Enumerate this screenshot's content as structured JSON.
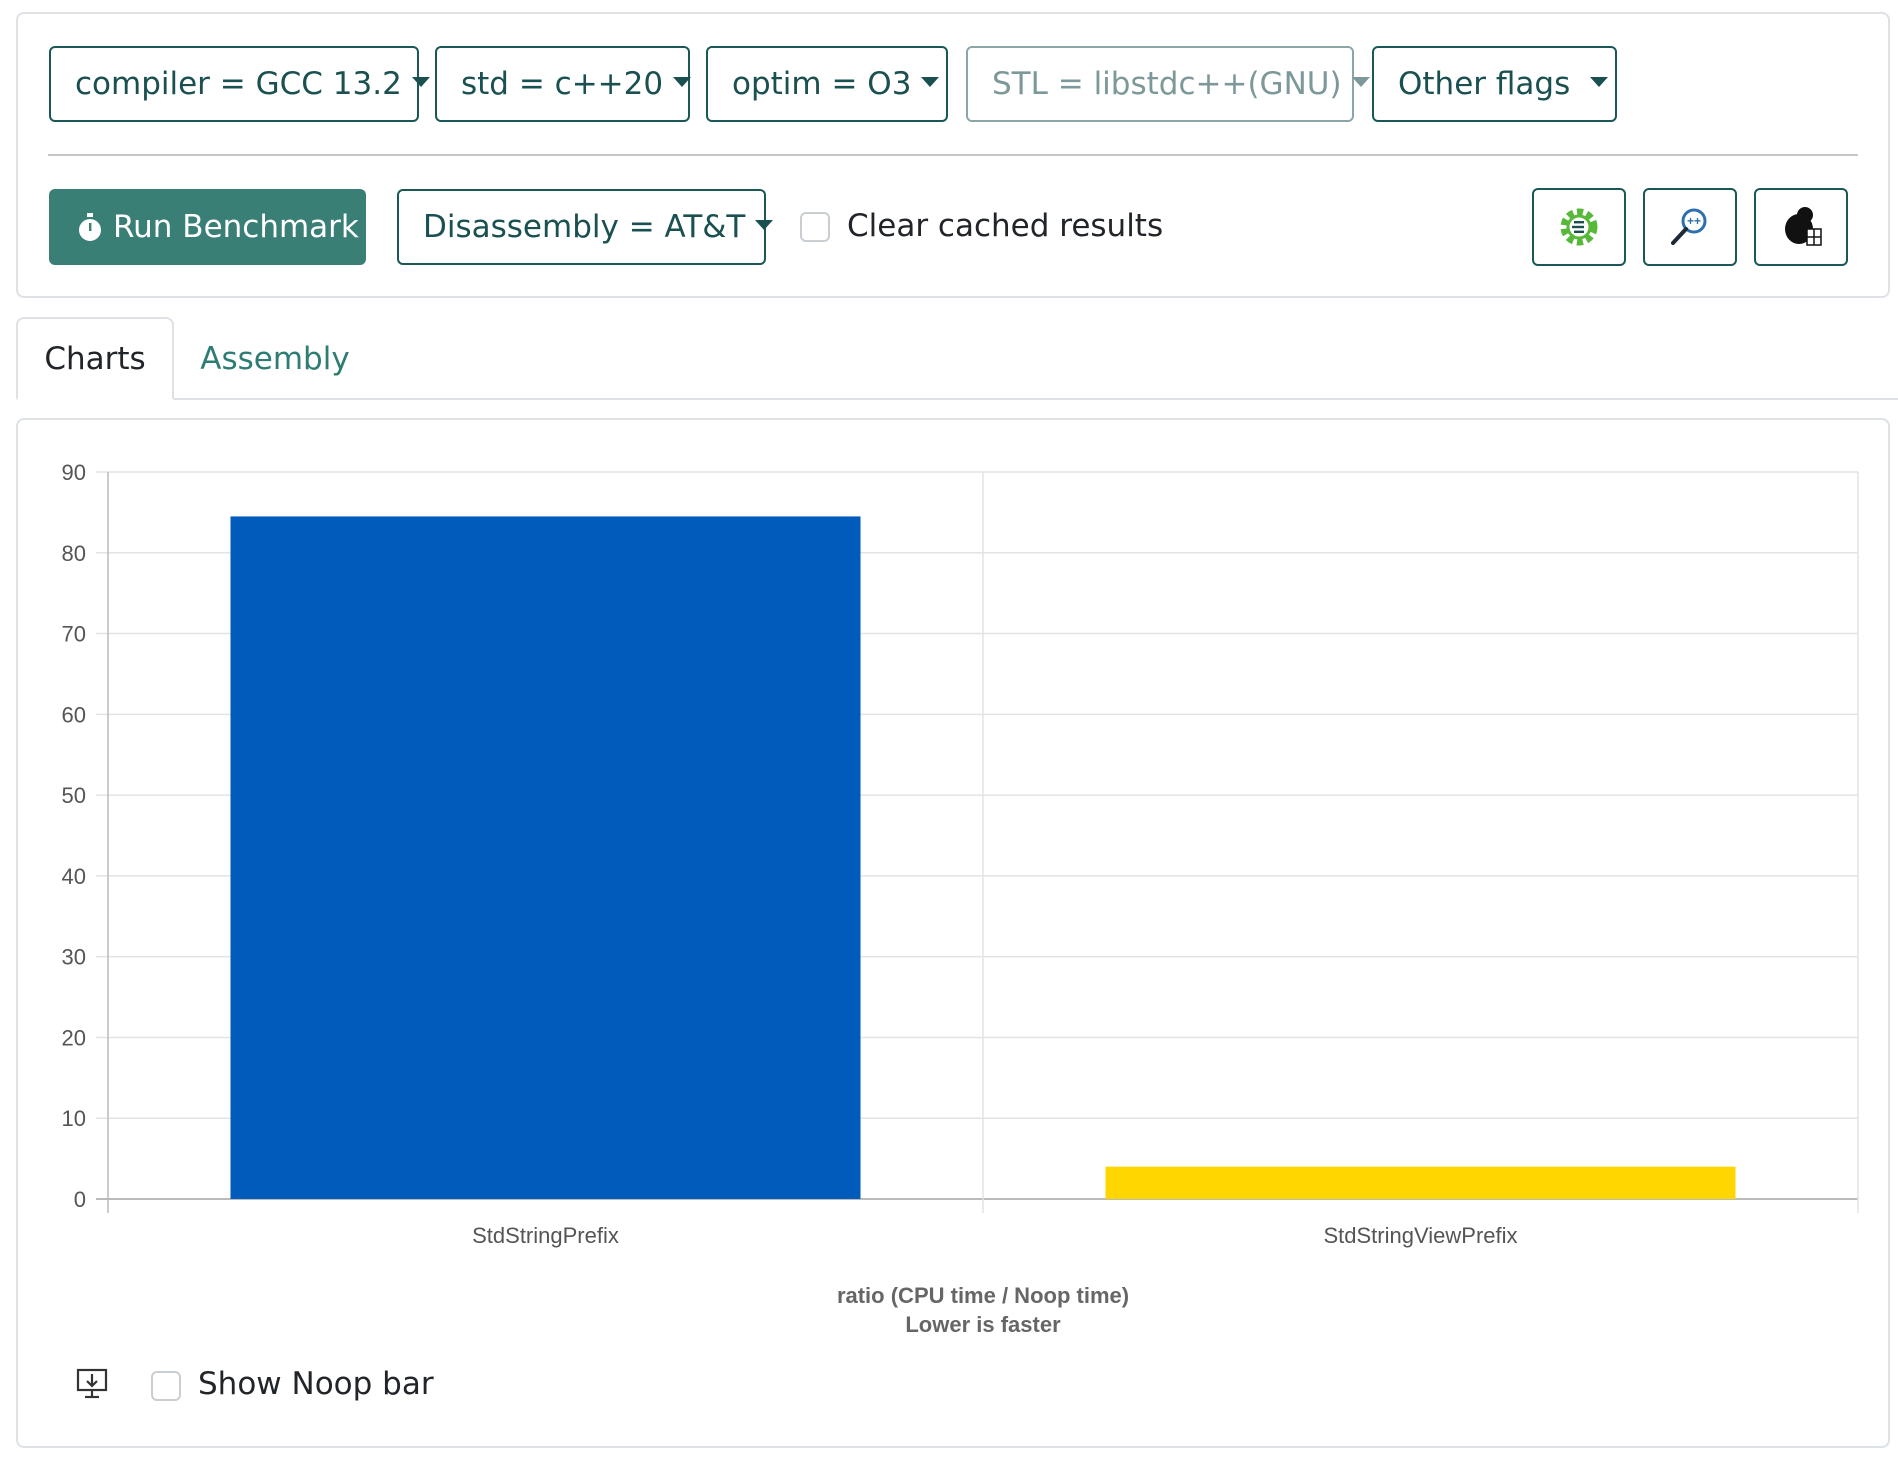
{
  "toolbar": {
    "compiler_label": "compiler = GCC 13.2",
    "std_label": "std = c++20",
    "optim_label": "optim = O3",
    "stl_label": "STL = libstdc++(GNU)",
    "other_flags_label": "Other flags",
    "run_label": "Run Benchmark",
    "disassembly_label": "Disassembly = AT&T",
    "clear_cache_label": "Clear cached results",
    "icons": [
      "quick-bench-icon",
      "build-bench-icon",
      "perf-bench-icon"
    ]
  },
  "tabs": [
    {
      "label": "Charts",
      "active": true
    },
    {
      "label": "Assembly",
      "active": false
    }
  ],
  "chart_data": {
    "type": "bar",
    "categories": [
      "StdStringPrefix",
      "StdStringViewPrefix"
    ],
    "values": [
      84.5,
      4
    ],
    "colors": [
      "#005bbb",
      "#ffd600"
    ],
    "ylim": [
      0,
      90
    ],
    "yticks": [
      0,
      10,
      20,
      30,
      40,
      50,
      60,
      70,
      80,
      90
    ],
    "xlabel_line1": "ratio (CPU time / Noop time)",
    "xlabel_line2": "Lower is faster",
    "grid": true
  },
  "chart_footer": {
    "show_noop_label": "Show Noop bar",
    "download_icon": "download-icon"
  },
  "colors": {
    "accent": "#3a7f76",
    "border": "#1a5858"
  }
}
